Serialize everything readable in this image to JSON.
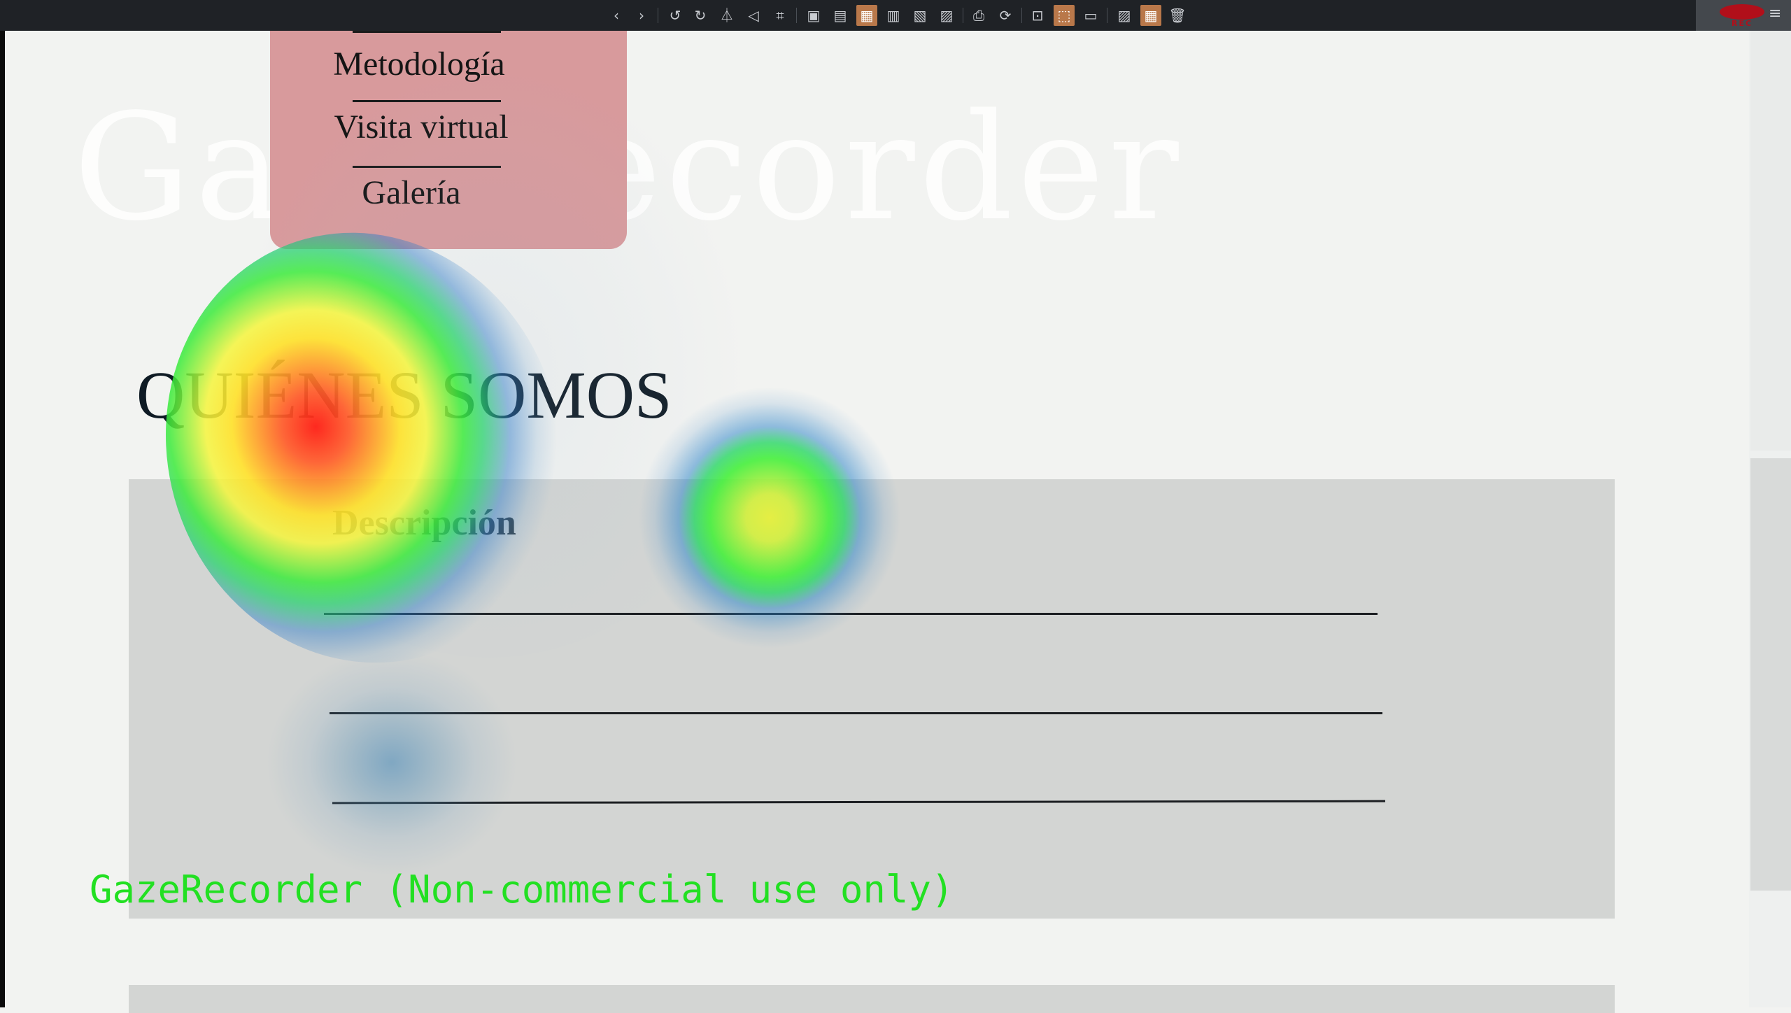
{
  "toolbar": {
    "buttons": [
      {
        "name": "back-icon",
        "glyph": "‹"
      },
      {
        "name": "forward-icon",
        "glyph": "›"
      },
      {
        "name": "rotate-left-icon",
        "glyph": "↺"
      },
      {
        "name": "rotate-right-icon",
        "glyph": "↻"
      },
      {
        "name": "flip-vertical-icon",
        "glyph": "⏃"
      },
      {
        "name": "flip-horizontal-icon",
        "glyph": "◁"
      },
      {
        "name": "crop-icon",
        "glyph": "⌗"
      },
      {
        "name": "frame-1-icon",
        "glyph": "▣"
      },
      {
        "name": "frame-2-icon",
        "glyph": "▤"
      },
      {
        "name": "frame-3-icon",
        "glyph": "▦"
      },
      {
        "name": "frame-4-icon",
        "glyph": "▥"
      },
      {
        "name": "frame-5-icon",
        "glyph": "▧"
      },
      {
        "name": "frame-6-icon",
        "glyph": "▨"
      },
      {
        "name": "print-icon",
        "glyph": "⎙"
      },
      {
        "name": "refresh-icon",
        "glyph": "⟳"
      },
      {
        "name": "fit-icon",
        "glyph": "⊡"
      },
      {
        "name": "expand-icon",
        "glyph": "⬚"
      },
      {
        "name": "screen-icon",
        "glyph": "▭"
      },
      {
        "name": "image-icon",
        "glyph": "▨"
      },
      {
        "name": "grid-icon",
        "glyph": "▦"
      },
      {
        "name": "trash-icon",
        "glyph": "🗑"
      }
    ],
    "rec_label": "REC",
    "menu_glyph": "≡"
  },
  "watermark_title": "GazeRecorder",
  "nav": {
    "items": [
      "Metodología",
      "Visita virtual",
      "Galería"
    ]
  },
  "main": {
    "section_title": "QUIÉNES SOMOS",
    "card_title": "Descripción"
  },
  "overlay": {
    "gaze_label": "GazeRecorder (Non-commercial use only)"
  },
  "colors": {
    "nav_bg": "#d89a9c",
    "card_bg": "#d3d5d3",
    "page_bg": "#f2f3f1",
    "label_green": "#22e022",
    "rec_red": "#b10f1a"
  }
}
